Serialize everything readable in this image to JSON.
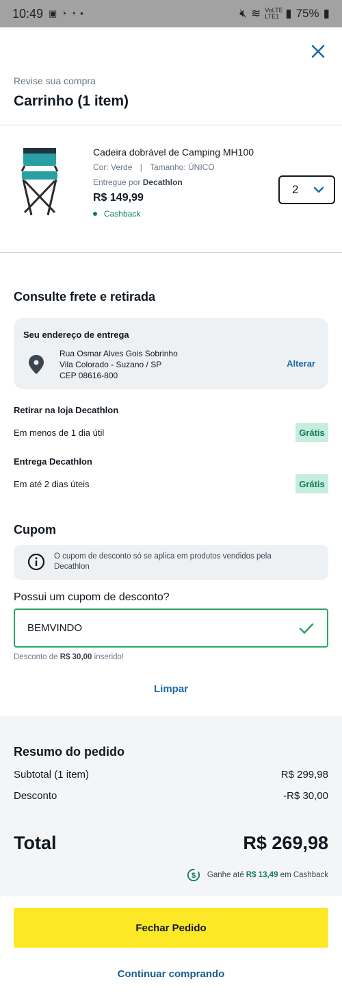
{
  "status_bar": {
    "time": "10:49",
    "network": "VoLTE LTE1",
    "battery": "75%"
  },
  "header": {
    "subtitle": "Revise sua compra",
    "title": "Carrinho (1 item)",
    "close_icon": "close-icon"
  },
  "product": {
    "name": "Cadeira dobrável de Camping MH100",
    "color": "Cor: Verde",
    "attr_separator": "|",
    "size": "Tamanho: ÚNICO",
    "seller_prefix": "Entregue por ",
    "seller": "Decathlon",
    "price": "R$ 149,99",
    "cashback": "Cashback",
    "quantity": "2"
  },
  "shipping": {
    "title": "Consulte frete e retirada",
    "address_card": {
      "heading": "Seu endereço de entrega",
      "line1": "Rua Osmar Alves Gois Sobrinho",
      "line2": "Vila Colorado - Suzano / SP",
      "line3": "CEP 08616-800",
      "change_label": "Alterar"
    },
    "options": [
      {
        "title": "Retirar na loja Decathlon",
        "desc": "Em menos de 1 dia útil",
        "price": "Grátis"
      },
      {
        "title": "Entrega Decathlon",
        "desc": "Em até 2 dias úteis",
        "price": "Grátis"
      }
    ]
  },
  "coupon": {
    "title": "Cupom",
    "info": "O cupom de desconto só se aplica em produtos vendidos pela Decathlon",
    "label": "Possui um cupom de desconto?",
    "value": "BEMVINDO",
    "msg_prefix": "Desconto de ",
    "msg_amount": "R$ 30,00",
    "msg_suffix": " inserido!",
    "clear_label": "Limpar"
  },
  "summary": {
    "title": "Resumo do pedido",
    "subtotal_label": "Subtotal (1 item)",
    "subtotal_value": "R$ 299,98",
    "discount_label": "Desconto",
    "discount_value": "-R$ 30,00",
    "total_label": "Total",
    "total_value": "R$ 269,98",
    "cashback_prefix": "Ganhe até ",
    "cashback_amount": "R$ 13,49",
    "cashback_suffix": " em Cashback"
  },
  "actions": {
    "checkout_label": "Fechar Pedido",
    "continue_label": "Continuar comprando"
  },
  "colors": {
    "accent_yellow": "#fde827",
    "link_blue": "#1b6aa5",
    "success_green": "#0f7d5a",
    "badge_bg": "#c7eddd"
  }
}
